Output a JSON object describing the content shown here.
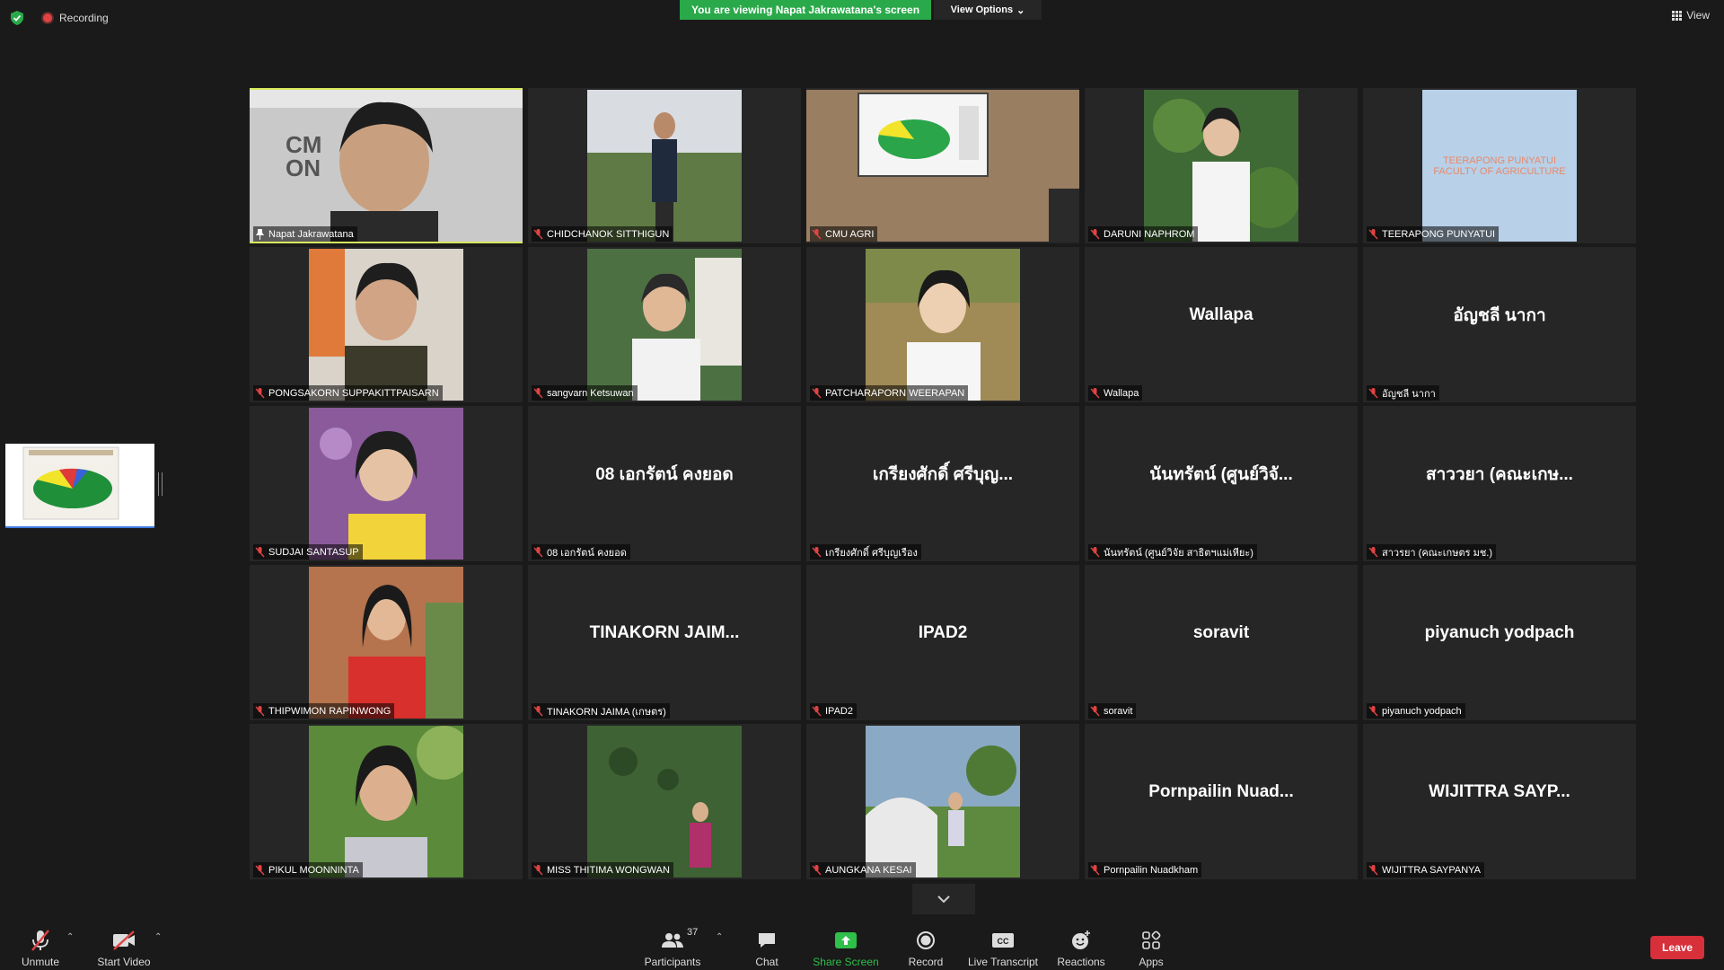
{
  "top": {
    "recording_label": "Recording",
    "banner_text": "You are viewing Napat Jakrawatana's screen",
    "view_options_label": "View Options",
    "view_label": "View"
  },
  "participants": [
    {
      "name": "Napat Jakrawatana",
      "type": "photo",
      "active": true,
      "icon": "pin-icon"
    },
    {
      "name": "CHIDCHANOK SITTHIGUN",
      "type": "photo"
    },
    {
      "name": "CMU AGRI",
      "type": "wide-photo"
    },
    {
      "name": "DARUNI NAPHROM",
      "type": "photo"
    },
    {
      "name": "TEERAPONG PUNYATUI",
      "type": "card",
      "card_lines": [
        "TEERAPONG PUNYATUI",
        "FACULTY OF AGRICULTURE"
      ]
    },
    {
      "name": "PONGSAKORN SUPPAKITTPAISARN",
      "type": "photo"
    },
    {
      "name": "sangvarn  Ketsuwan",
      "type": "photo"
    },
    {
      "name": "PATCHARAPORN WEERAPAN",
      "type": "photo"
    },
    {
      "name": "Wallapa",
      "type": "name",
      "display": "Wallapa"
    },
    {
      "name": "อัญชลี นากา",
      "type": "name",
      "display": "อัญชลี นากา"
    },
    {
      "name": "SUDJAI SANTASUP",
      "type": "photo"
    },
    {
      "name": "08 เอกรัตน์ คงยอด",
      "type": "name",
      "display": "08 เอกรัตน์ คงยอด"
    },
    {
      "name": "เกรียงศักดิ์ ศรีบุญเรือง",
      "type": "name",
      "display": "เกรียงศักดิ์ ศรีบุญ..."
    },
    {
      "name": "นันทรัตน์ (ศูนย์วิจัย สาธิตฯแม่เหียะ)",
      "type": "name",
      "display": "นันทรัตน์ (ศูนย์วิจั..."
    },
    {
      "name": "สาวรยา (คณะเกษตร มช.)",
      "type": "name",
      "display": "สาววยา (คณะเกษ..."
    },
    {
      "name": "THIPWIMON RAPINWONG",
      "type": "photo"
    },
    {
      "name": "TINAKORN JAIMA (เกษตร)",
      "type": "name",
      "display": "TINAKORN  JAIM..."
    },
    {
      "name": "IPAD2",
      "type": "name",
      "display": "IPAD2"
    },
    {
      "name": "soravit",
      "type": "name",
      "display": "soravit"
    },
    {
      "name": "piyanuch yodpach",
      "type": "name",
      "display": "piyanuch yodpach"
    },
    {
      "name": "PIKUL MOONNINTA",
      "type": "photo"
    },
    {
      "name": "MISS THITIMA WONGWAN",
      "type": "photo"
    },
    {
      "name": "AUNGKANA KESAI",
      "type": "photo"
    },
    {
      "name": "Pornpailin Nuadkham",
      "type": "name",
      "display": "Pornpailin  Nuad..."
    },
    {
      "name": "WIJITTRA SAYPANYA",
      "type": "name",
      "display": "WIJITTRA  SAYP..."
    }
  ],
  "toolbar": {
    "unmute": "Unmute",
    "start_video": "Start Video",
    "participants": "Participants",
    "participant_count": "37",
    "chat": "Chat",
    "share_screen": "Share Screen",
    "record": "Record",
    "live_transcript": "Live Transcript",
    "reactions": "Reactions",
    "apps": "Apps",
    "leave": "Leave"
  },
  "colors": {
    "background": "#1a1a1a",
    "tile": "#262626",
    "banner_green": "#2aa94a",
    "active_border": "#d7e95a",
    "leave_red": "#d7303a",
    "mute_red": "#e04343"
  }
}
